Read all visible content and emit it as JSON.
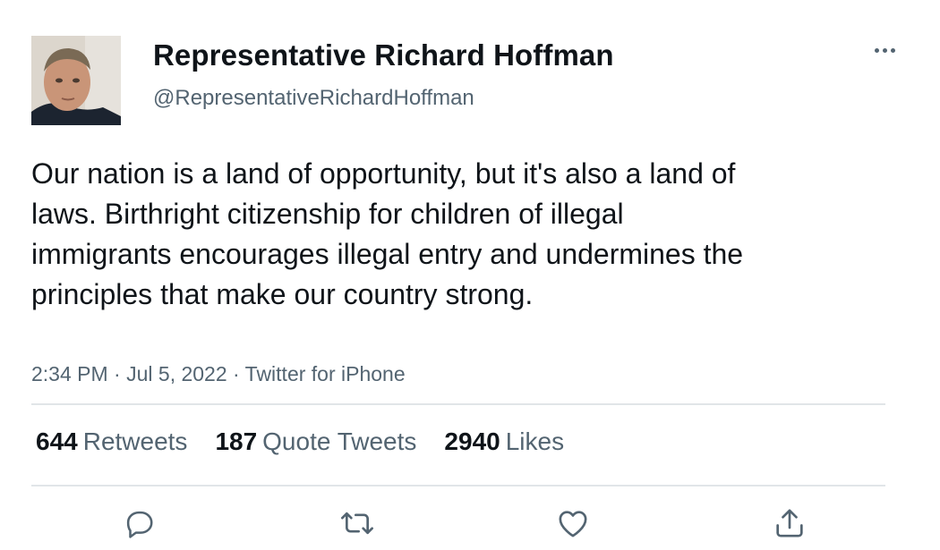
{
  "author": {
    "display_name": "Representative Richard Hoffman",
    "handle": "@RepresentativeRichardHoffman"
  },
  "tweet": {
    "text": "Our nation is a land of opportunity, but it's also a land of laws. Birthright citizenship for children of illegal immigrants encourages illegal entry and undermines the principles that make our country strong.",
    "time": "2:34 PM",
    "date": "Jul 5, 2022",
    "source": "Twitter for iPhone",
    "separator": "·"
  },
  "stats": {
    "retweets_count": "644",
    "retweets_label": "Retweets",
    "quotes_count": "187",
    "quotes_label": "Quote Tweets",
    "likes_count": "2940",
    "likes_label": "Likes"
  },
  "actions": [
    {
      "icon": "reply-icon"
    },
    {
      "icon": "retweet-icon"
    },
    {
      "icon": "like-icon"
    },
    {
      "icon": "share-icon"
    }
  ],
  "colors": {
    "text_primary": "#0f1419",
    "text_secondary": "#536471",
    "divider": "#e1e5e8"
  }
}
